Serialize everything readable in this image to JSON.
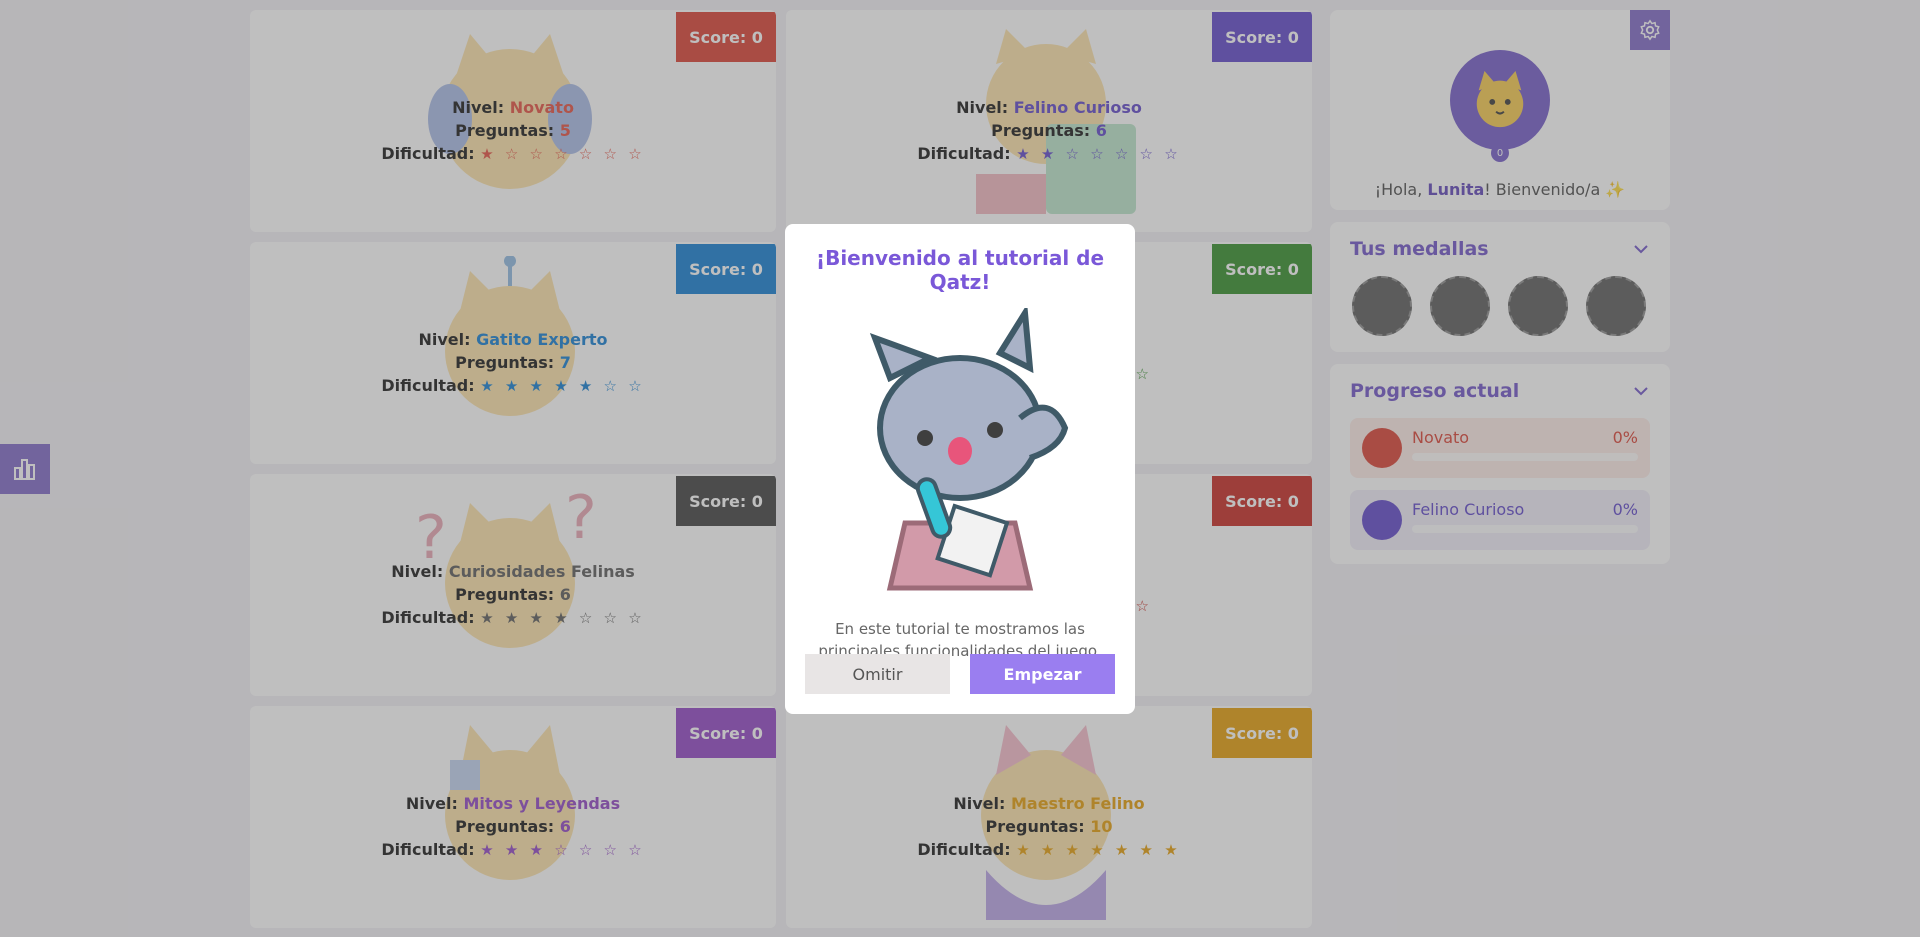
{
  "cards": [
    {
      "score_label": "Score: 0",
      "score_color": "#d93a2b",
      "nivel_label": "Nivel:",
      "nivel": "Novato",
      "accent": "#e4493a",
      "preguntas_label": "Preguntas:",
      "preguntas": "5",
      "dificultad_label": "Dificultad:",
      "stars": "★ ☆ ☆ ☆ ☆ ☆ ☆",
      "stars_color": "#e4493a"
    },
    {
      "score_label": "Score: 0",
      "score_color": "#5a40c8",
      "nivel_label": "Nivel:",
      "nivel": "Felino Curioso",
      "accent": "#5a40c8",
      "preguntas_label": "Preguntas:",
      "preguntas": "6",
      "dificultad_label": "Dificultad:",
      "stars": "★ ★ ☆ ☆ ☆ ☆ ☆",
      "stars_color": "#5a40c8"
    },
    {
      "score_label": "Score: 0",
      "score_color": "#0b79d0",
      "nivel_label": "Nivel:",
      "nivel": "Gatito Experto",
      "accent": "#0b79d0",
      "preguntas_label": "Preguntas:",
      "preguntas": "7",
      "dificultad_label": "Dificultad:",
      "stars": "★ ★ ★ ★ ★ ☆ ☆",
      "stars_color": "#0b79d0"
    },
    {
      "score_label": "Score: 0",
      "score_color": "#2c8a22",
      "nivel_label": "",
      "nivel": "",
      "accent": "#2c8a22",
      "preguntas_label": "",
      "preguntas": "",
      "dificultad_label": "",
      "stars": "☆",
      "stars_color": "#2c8a22"
    },
    {
      "score_label": "Score: 0",
      "score_color": "#3a3a3a",
      "nivel_label": "Nivel:",
      "nivel": "Curiosidades Felinas",
      "accent": "#555555",
      "preguntas_label": "Preguntas:",
      "preguntas": "6",
      "dificultad_label": "Dificultad:",
      "stars": "★ ★ ★ ★ ☆ ☆ ☆",
      "stars_color": "#555555"
    },
    {
      "score_label": "Score: 0",
      "score_color": "#c4221a",
      "nivel_label": "",
      "nivel": "",
      "accent": "#c4221a",
      "preguntas_label": "",
      "preguntas": "",
      "dificultad_label": "",
      "stars": "☆",
      "stars_color": "#c4221a"
    },
    {
      "score_label": "Score: 0",
      "score_color": "#8e3fc3",
      "nivel_label": "Nivel:",
      "nivel": "Mitos y Leyendas",
      "accent": "#8e3fc3",
      "preguntas_label": "Preguntas:",
      "preguntas": "6",
      "dificultad_label": "Dificultad:",
      "stars": "★ ★ ★ ☆ ☆ ☆ ☆",
      "stars_color": "#8e3fc3"
    },
    {
      "score_label": "Score: 0",
      "score_color": "#e49a00",
      "nivel_label": "Nivel:",
      "nivel": "Maestro Felino",
      "accent": "#e49a00",
      "preguntas_label": "Preguntas:",
      "preguntas": "10",
      "dificultad_label": "Dificultad:",
      "stars": "★ ★ ★ ★ ★ ★ ★",
      "stars_color": "#e49a00"
    }
  ],
  "profile": {
    "avatar_badge": "0",
    "greeting_prefix": "¡Hola, ",
    "username": "Lunita",
    "greeting_suffix": "! Bienvenido/a ✨"
  },
  "medals": {
    "title": "Tus medallas"
  },
  "progress": {
    "title": "Progreso actual",
    "items": [
      {
        "name": "Novato",
        "percent": "0%",
        "color": "#d93a2b",
        "bg": "#fdeae6"
      },
      {
        "name": "Felino Curioso",
        "percent": "0%",
        "color": "#5a40c8",
        "bg": "#efedf8"
      }
    ]
  },
  "modal": {
    "title": "¡Bienvenido al tutorial de Qatz!",
    "description": "En este tutorial te mostramos las principales funcionalidades del juego.",
    "skip_label": "Omitir",
    "start_label": "Empezar"
  },
  "icons": {
    "sidebar": "chart-bars-icon",
    "settings": "gear-icon",
    "chevron": "chevron-down-icon"
  }
}
